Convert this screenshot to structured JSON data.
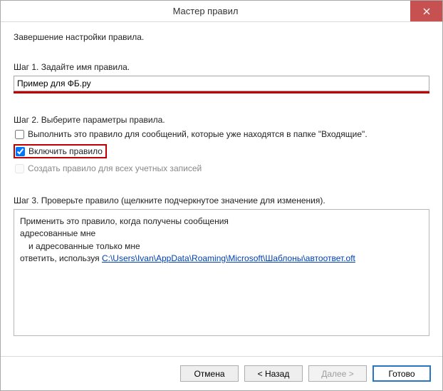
{
  "window": {
    "title": "Мастер правил"
  },
  "intro": "Завершение настройки правила.",
  "step1": {
    "label": "Шаг 1. Задайте имя правила.",
    "value": "Пример для ФБ.ру"
  },
  "step2": {
    "label": "Шаг 2. Выберите параметры правила.",
    "opt1": {
      "label": "Выполнить это правило для сообщений, которые уже находятся в папке \"Входящие\".",
      "checked": false
    },
    "opt2": {
      "label": "Включить правило",
      "checked": true
    },
    "opt3": {
      "label": "Создать правило для всех учетных записей",
      "checked": false,
      "disabled": true
    }
  },
  "step3": {
    "label": "Шаг 3. Проверьте правило (щелкните подчеркнутое значение для изменения).",
    "line1": "Применить это правило, когда получены сообщения",
    "line2": "адресованные мне",
    "line3": "и адресованные только мне",
    "line4_prefix": "ответить, используя ",
    "line4_link": "C:\\Users\\Ivan\\AppData\\Roaming\\Microsoft\\Шаблоны\\автоответ.oft"
  },
  "buttons": {
    "cancel": "Отмена",
    "back": "< Назад",
    "next": "Далее >",
    "finish": "Готово"
  }
}
